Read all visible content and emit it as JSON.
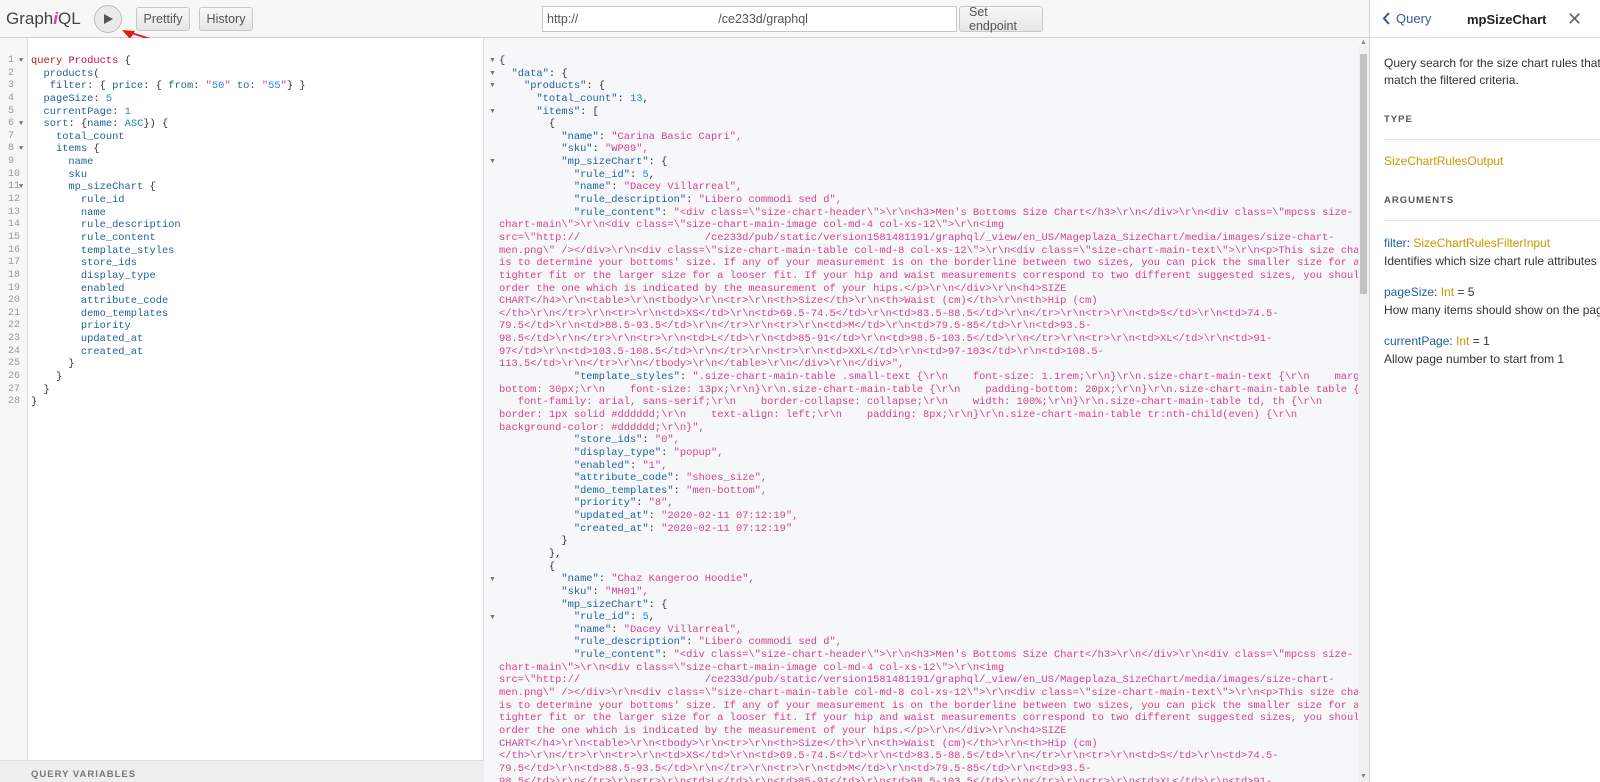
{
  "app": {
    "logo_pre": "Graph",
    "logo_i": "i",
    "logo_post": "QL"
  },
  "toolbar": {
    "prettify_label": "Prettify",
    "history_label": "History",
    "endpoint_prefix": "http://",
    "endpoint_suffix": "/ce233d/graphql",
    "set_endpoint_label": "Set endpoint"
  },
  "editor": {
    "query_variables_label": "QUERY VARIABLES"
  },
  "docs": {
    "back_label": "Query",
    "title": "mpSizeChart",
    "description": "Query search for the size chart rules that match the filtered criteria.",
    "type_heading": "TYPE",
    "type_name": "SizeChartRulesOutput",
    "arguments_heading": "ARGUMENTS",
    "args": [
      {
        "name": "filter",
        "type": "SizeChartRulesFilterInput",
        "default": "",
        "desc": "Identifies which size chart rule attributes to search for and return."
      },
      {
        "name": "pageSize",
        "type": "Int",
        "default": " = 5",
        "desc": "How many items should show on the page."
      },
      {
        "name": "currentPage",
        "type": "Int",
        "default": " = 1",
        "desc": "Allow page number to start from 1"
      }
    ]
  },
  "colors": {
    "keyword": "#b11a04",
    "property": "#1f61a0",
    "string": "#d64292",
    "number": "#2882f9",
    "type": "#ca9800"
  },
  "query_lines": [
    "query Products {",
    "  products(",
    "   filter: { price: { from: \"50\" to: \"55\"} }",
    "  pageSize: 5",
    "  currentPage: 1",
    "  sort: {name: ASC}) {",
    "    total_count",
    "    items {",
    "      name",
    "      sku",
    "      mp_sizeChart {",
    "        rule_id",
    "        name",
    "        rule_description",
    "        rule_content",
    "        template_styles",
    "        store_ids",
    "        display_type",
    "        enabled",
    "        attribute_code",
    "        demo_templates",
    "        priority",
    "        updated_at",
    "        created_at",
    "      }",
    "    }",
    "  }",
    "}"
  ],
  "result_lines": [
    "{",
    "  \"data\": {",
    "    \"products\": {",
    "      \"total_count\": 13,",
    "      \"items\": [",
    "        {",
    "          \"name\": \"Carina Basic Capri\",",
    "          \"sku\": \"WP09\",",
    "          \"mp_sizeChart\": {",
    "            \"rule_id\": 5,",
    "            \"name\": \"Dacey Villarreal\",",
    "            \"rule_description\": \"Libero commodi sed d\",",
    "            \"rule_content\": \"<div class=\\\"size-chart-header\\\">\\r\\n<h3>Men's Bottoms Size Chart</h3>\\r\\n</div>\\r\\n<div class=\\\"mpcss size-",
    "chart-main\\\">\\r\\n<div class=\\\"size-chart-main-image col-md-4 col-xs-12\\\">\\r\\n<img",
    "src=\\\"http://                    /ce233d/pub/static/version1581481191/graphql/_view/en_US/Mageplaza_SizeChart/media/images/size-chart-",
    "men.png\\\" /></div>\\r\\n<div class=\\\"size-chart-main-table col-md-8 col-xs-12\\\">\\r\\n<div class=\\\"size-chart-main-text\\\">\\r\\n<p>This size chart",
    "is to determine your bottoms' size. If any of your measurement is on the borderline between two sizes, you can pick the smaller size for a",
    "tighter fit or the larger size for a looser fit. If your hip and waist measurements correspond to two different suggested sizes, you should",
    "order the one which is indicated by the measurement of your hips.</p>\\r\\n</div>\\r\\n<h4>SIZE",
    "CHART</h4>\\r\\n<table>\\r\\n<tbody>\\r\\n<tr>\\r\\n<th>Size</th>\\r\\n<th>Waist (cm)</th>\\r\\n<th>Hip (cm)",
    "</th>\\r\\n</tr>\\r\\n<tr>\\r\\n<td>XS</td>\\r\\n<td>69.5-74.5</td>\\r\\n<td>83.5-88.5</td>\\r\\n</tr>\\r\\n<tr>\\r\\n<td>S</td>\\r\\n<td>74.5-",
    "79.5</td>\\r\\n<td>88.5-93.5</td>\\r\\n</tr>\\r\\n<tr>\\r\\n<td>M</td>\\r\\n<td>79.5-85</td>\\r\\n<td>93.5-",
    "98.5</td>\\r\\n</tr>\\r\\n<tr>\\r\\n<td>L</td>\\r\\n<td>85-91</td>\\r\\n<td>98.5-103.5</td>\\r\\n</tr>\\r\\n<tr>\\r\\n<td>XL</td>\\r\\n<td>91-",
    "97</td>\\r\\n<td>103.5-108.5</td>\\r\\n</tr>\\r\\n<tr>\\r\\n<td>XXL</td>\\r\\n<td>97-103</td>\\r\\n<td>108.5-",
    "113.5</td>\\r\\n</tr>\\r\\n</tbody>\\r\\n</table>\\r\\n</div>\\r\\n</div>\",",
    "            \"template_styles\": \".size-chart-main-table .small-text {\\r\\n    font-size: 1.1rem;\\r\\n}\\r\\n.size-chart-main-text {\\r\\n    margin-",
    "bottom: 30px;\\r\\n    font-size: 13px;\\r\\n}\\r\\n.size-chart-main-table {\\r\\n    padding-bottom: 20px;\\r\\n}\\r\\n.size-chart-main-table table {\\r\\n",
    "   font-family: arial, sans-serif;\\r\\n    border-collapse: collapse;\\r\\n    width: 100%;\\r\\n}\\r\\n.size-chart-main-table td, th {\\r\\n",
    "border: 1px solid #dddddd;\\r\\n    text-align: left;\\r\\n    padding: 8px;\\r\\n}\\r\\n.size-chart-main-table tr:nth-child(even) {\\r\\n",
    "background-color: #dddddd;\\r\\n}\",",
    "            \"store_ids\": \"0\",",
    "            \"display_type\": \"popup\",",
    "            \"enabled\": \"1\",",
    "            \"attribute_code\": \"shoes_size\",",
    "            \"demo_templates\": \"men-bottom\",",
    "            \"priority\": \"8\",",
    "            \"updated_at\": \"2020-02-11 07:12:19\",",
    "            \"created_at\": \"2020-02-11 07:12:19\"",
    "          }",
    "        },",
    "        {",
    "          \"name\": \"Chaz Kangeroo Hoodie\",",
    "          \"sku\": \"MH01\",",
    "          \"mp_sizeChart\": {",
    "            \"rule_id\": 5,",
    "            \"name\": \"Dacey Villarreal\",",
    "            \"rule_description\": \"Libero commodi sed d\",",
    "            \"rule_content\": \"<div class=\\\"size-chart-header\\\">\\r\\n<h3>Men's Bottoms Size Chart</h3>\\r\\n</div>\\r\\n<div class=\\\"mpcss size-",
    "chart-main\\\">\\r\\n<div class=\\\"size-chart-main-image col-md-4 col-xs-12\\\">\\r\\n<img",
    "src=\\\"http://                    /ce233d/pub/static/version1581481191/graphql/_view/en_US/Mageplaza_SizeChart/media/images/size-chart-",
    "men.png\\\" /></div>\\r\\n<div class=\\\"size-chart-main-table col-md-8 col-xs-12\\\">\\r\\n<div class=\\\"size-chart-main-text\\\">\\r\\n<p>This size chart",
    "is to determine your bottoms' size. If any of your measurement is on the borderline between two sizes, you can pick the smaller size for a",
    "tighter fit or the larger size for a looser fit. If your hip and waist measurements correspond to two different suggested sizes, you should",
    "order the one which is indicated by the measurement of your hips.</p>\\r\\n</div>\\r\\n<h4>SIZE",
    "CHART</h4>\\r\\n<table>\\r\\n<tbody>\\r\\n<tr>\\r\\n<th>Size</th>\\r\\n<th>Waist (cm)</th>\\r\\n<th>Hip (cm)",
    "</th>\\r\\n</tr>\\r\\n<tr>\\r\\n<td>XS</td>\\r\\n<td>69.5-74.5</td>\\r\\n<td>83.5-88.5</td>\\r\\n</tr>\\r\\n<tr>\\r\\n<td>S</td>\\r\\n<td>74.5-",
    "79.5</td>\\r\\n<td>88.5-93.5</td>\\r\\n</tr>\\r\\n<tr>\\r\\n<td>M</td>\\r\\n<td>79.5-85</td>\\r\\n<td>93.5-",
    "98.5</td>\\r\\n</tr>\\r\\n<tr>\\r\\n<td>L</td>\\r\\n<td>85-91</td>\\r\\n<td>98.5-103.5</td>\\r\\n</tr>\\r\\n<tr>\\r\\n<td>XL</td>\\r\\n<td>91-"
  ]
}
